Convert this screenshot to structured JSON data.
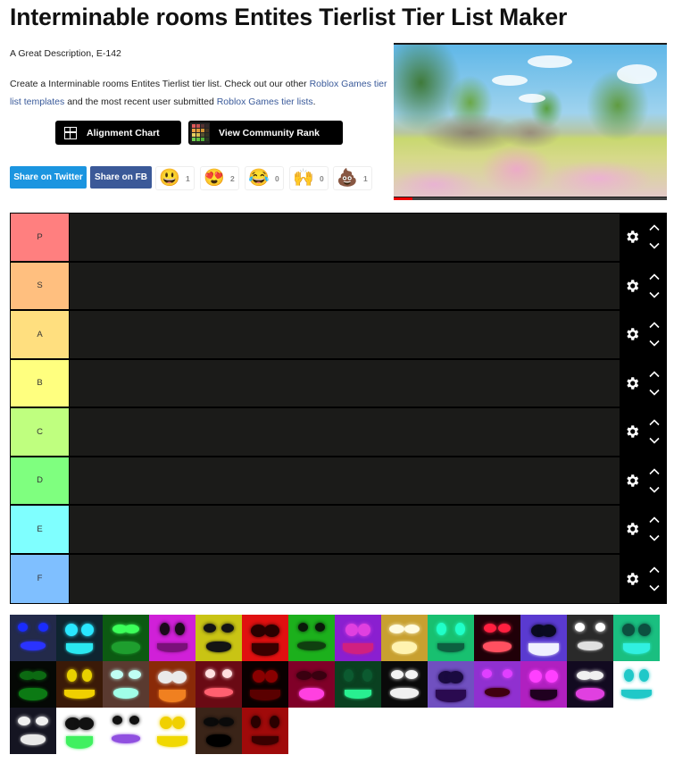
{
  "page": {
    "title": "Interminable rooms Entites Tierlist Tier List Maker",
    "description": "A Great Description, E-142",
    "intro": {
      "prefix": "Create a Interminable rooms Entites Tierlist tier list. Check out our other ",
      "link1": "Roblox Games tier list templates",
      "middle": " and the most recent user submitted ",
      "link2": "Roblox Games tier lists",
      "suffix": "."
    }
  },
  "actions": {
    "alignment_chart": "Alignment Chart",
    "community_rank": "View Community Rank"
  },
  "share": {
    "twitter": "Share on Twitter",
    "facebook": "Share on FB"
  },
  "reactions": [
    {
      "icon": "grinning-face-icon",
      "emoji": "😃",
      "count": "1"
    },
    {
      "icon": "heart-eyes-icon",
      "emoji": "😍",
      "count": "2"
    },
    {
      "icon": "tears-of-joy-icon",
      "emoji": "😂",
      "count": "0"
    },
    {
      "icon": "raising-hands-icon",
      "emoji": "🙌",
      "count": "0"
    },
    {
      "icon": "poop-icon",
      "emoji": "💩",
      "count": "1"
    }
  ],
  "video": {
    "progress_percent": 7
  },
  "tiers": [
    {
      "label": "P",
      "color": "#ff7f7f"
    },
    {
      "label": "S",
      "color": "#ffbf7f"
    },
    {
      "label": "A",
      "color": "#ffdf7f"
    },
    {
      "label": "B",
      "color": "#ffff7f"
    },
    {
      "label": "C",
      "color": "#bfff7f"
    },
    {
      "label": "D",
      "color": "#7fff7f"
    },
    {
      "label": "E",
      "color": "#7fffff"
    },
    {
      "label": "F",
      "color": "#7fbfff"
    }
  ],
  "pool": [
    {
      "name": "blue-frog-face",
      "bg": "#232a4a",
      "eye": "#1a2cff",
      "mouth": "#2a33ff"
    },
    {
      "name": "cyan-swirl-face",
      "bg": "#0f2430",
      "eye": "#29e6ff",
      "mouth": "#2ae8f0"
    },
    {
      "name": "green-big-eyes",
      "bg": "#0c5a12",
      "eye": "#3cff5a",
      "mouth": "#1e9e2e"
    },
    {
      "name": "magenta-oval-eyes",
      "bg": "#d020d8",
      "eye": "#1a0a1a",
      "mouth": "#7a107a"
    },
    {
      "name": "yellow-scribble",
      "bg": "#c9c414",
      "eye": "#141414",
      "mouth": "#141414"
    },
    {
      "name": "red-grin-face",
      "bg": "#e01010",
      "eye": "#2a0000",
      "mouth": "#3a0000"
    },
    {
      "name": "green-dark-eyes",
      "bg": "#1cb01c",
      "eye": "#0a1a0a",
      "mouth": "#0f3f0f"
    },
    {
      "name": "purple-mustache",
      "bg": "#8a1fd0",
      "eye": "#e040e0",
      "mouth": "#d02080"
    },
    {
      "name": "yellow-pixel-skull",
      "bg": "#c8a030",
      "eye": "#fffbe0",
      "mouth": "#fff3b0"
    },
    {
      "name": "green-one-eye",
      "bg": "#18c070",
      "eye": "#20ffc8",
      "mouth": "#0c6040"
    },
    {
      "name": "red-cyclops-grin",
      "bg": "#200008",
      "eye": "#ff2040",
      "mouth": "#ff5060"
    },
    {
      "name": "purple-sharp-grin",
      "bg": "#5a3ad0",
      "eye": "#0a0a20",
      "mouth": "#f0f0ff"
    },
    {
      "name": "white-glow-hand",
      "bg": "#2a2a2a",
      "eye": "#ffffff",
      "mouth": "#e0e0e0"
    },
    {
      "name": "cyan-many-eyes",
      "bg": "#1abf80",
      "eye": "#0c5040",
      "mouth": "#30f0e0"
    },
    {
      "name": "dark-green-smile",
      "bg": "#050805",
      "eye": "#0c6a12",
      "mouth": "#0c7a14"
    },
    {
      "name": "yellow-tongue",
      "bg": "#3a1a08",
      "eye": "#e8d000",
      "mouth": "#f0d000"
    },
    {
      "name": "ice-glow-face",
      "bg": "#5a3a30",
      "eye": "#c0fff4",
      "mouth": "#a0ffe8"
    },
    {
      "name": "orange-beak",
      "bg": "#8a2a08",
      "eye": "#eaeaea",
      "mouth": "#f08020"
    },
    {
      "name": "red-many-eyes",
      "bg": "#6a0a14",
      "eye": "#ffe0e0",
      "mouth": "#ff6070"
    },
    {
      "name": "dark-red-shadow",
      "bg": "#0a0000",
      "eye": "#8a0000",
      "mouth": "#5a0000"
    },
    {
      "name": "pink-smile",
      "bg": "#800028",
      "eye": "#3a0010",
      "mouth": "#ff40e0"
    },
    {
      "name": "green-sad-face",
      "bg": "#0a4020",
      "eye": "#0c5a30",
      "mouth": "#28f090"
    },
    {
      "name": "white-screaming-face",
      "bg": "#0a0a0a",
      "eye": "#f4f4f4",
      "mouth": "#f0f0f0"
    },
    {
      "name": "purple-goggle-creature",
      "bg": "#7050c0",
      "eye": "#1a0a40",
      "mouth": "#2a0a50"
    },
    {
      "name": "purple-tube-orbs",
      "bg": "#9030d0",
      "eye": "#e040ff",
      "mouth": "#400010"
    },
    {
      "name": "magenta-fang-mouth",
      "bg": "#b020c0",
      "eye": "#ff40ff",
      "mouth": "#200020"
    },
    {
      "name": "white-glow-purple-mouth",
      "bg": "#120a20",
      "eye": "#f0f0f0",
      "mouth": "#e040e0"
    },
    {
      "name": "cyan-drawn-smile",
      "bg": "#ffffff",
      "eye": "#20c8c8",
      "mouth": "#20c8c8"
    },
    {
      "name": "white-spiral-grin",
      "bg": "#151522",
      "eye": "#f0f0f0",
      "mouth": "#e8e8e8"
    },
    {
      "name": "green-teeth-smile",
      "bg": "#ffffff",
      "eye": "#111111",
      "mouth": "#40f060"
    },
    {
      "name": "purple-lips-smile",
      "bg": "#ffffff",
      "eye": "#111111",
      "mouth": "#9050e0"
    },
    {
      "name": "yellow-banana-grin",
      "bg": "#ffffff",
      "eye": "#f0d000",
      "mouth": "#f0d800"
    },
    {
      "name": "shadow-figure",
      "bg": "#3a2418",
      "eye": "#0a0a0a",
      "mouth": "#000000"
    },
    {
      "name": "red-fuzzy-face",
      "bg": "#a00a0a",
      "eye": "#2a0000",
      "mouth": "#3a0000"
    }
  ]
}
